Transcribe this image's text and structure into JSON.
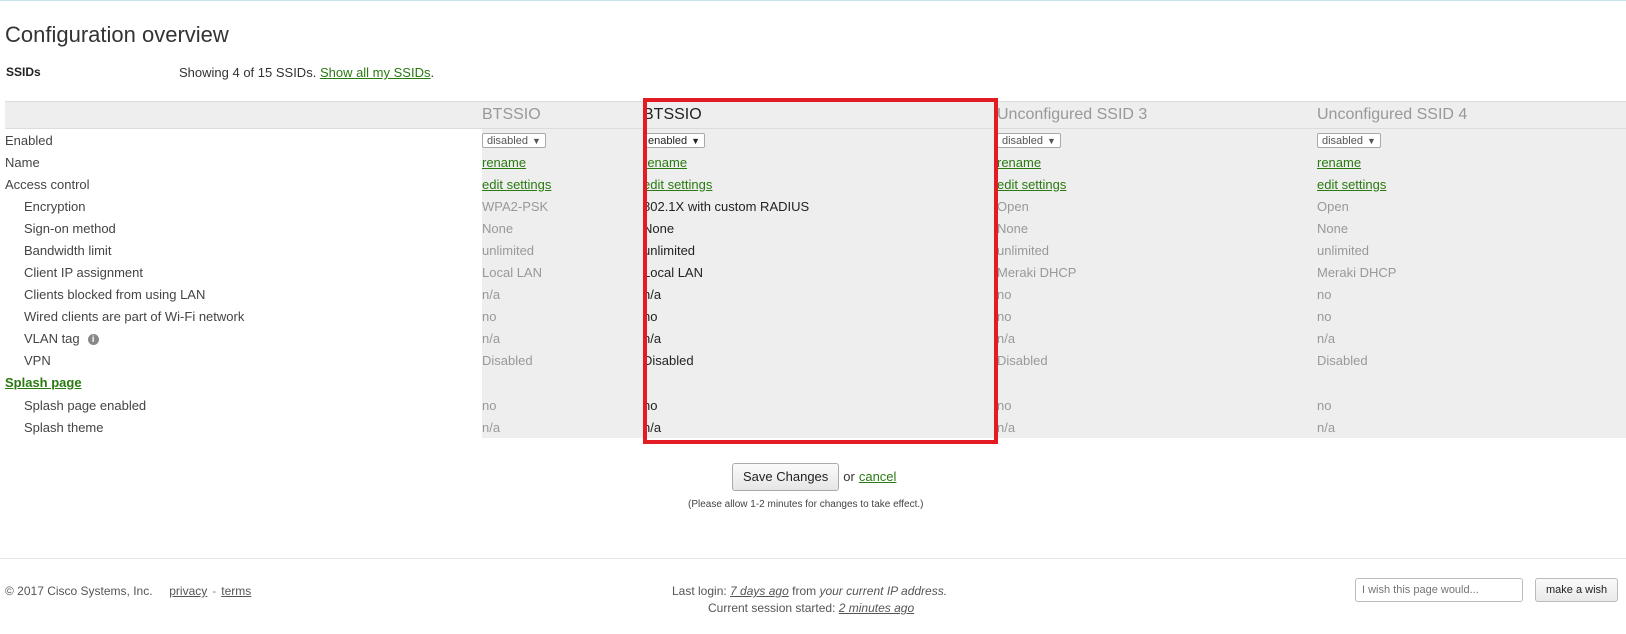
{
  "page": {
    "title": "Configuration overview",
    "ssids_label": "SSIDs",
    "ssids_info": "Showing 4 of 15 SSIDs.",
    "show_all_link": "Show all my SSIDs",
    "show_all_suffix": "."
  },
  "table": {
    "columns": [
      {
        "name": "BTSSIO",
        "enabled": "disabled",
        "rename": "rename",
        "access": "edit settings",
        "encryption": "WPA2-PSK",
        "signon": "None",
        "bandwidth": "unlimited",
        "client_ip": "Local LAN",
        "clients_blocked": "n/a",
        "wired_clients": "no",
        "vlan": "n/a",
        "vpn": "Disabled",
        "splash_enabled": "no",
        "splash_theme": "n/a"
      },
      {
        "name": "BTSSIO",
        "enabled": "enabled",
        "rename": "rename",
        "access": "edit settings",
        "encryption": "802.1X with custom RADIUS",
        "signon": "None",
        "bandwidth": "unlimited",
        "client_ip": "Local LAN",
        "clients_blocked": "n/a",
        "wired_clients": "no",
        "vlan": "n/a",
        "vpn": "Disabled",
        "splash_enabled": "no",
        "splash_theme": "n/a"
      },
      {
        "name": "Unconfigured SSID 3",
        "enabled": "disabled",
        "rename": "rename",
        "access": "edit settings",
        "encryption": "Open",
        "signon": "None",
        "bandwidth": "unlimited",
        "client_ip": "Meraki DHCP",
        "clients_blocked": "no",
        "wired_clients": "no",
        "vlan": "n/a",
        "vpn": "Disabled",
        "splash_enabled": "no",
        "splash_theme": "n/a"
      },
      {
        "name": "Unconfigured SSID 4",
        "enabled": "disabled",
        "rename": "rename",
        "access": "edit settings",
        "encryption": "Open",
        "signon": "None",
        "bandwidth": "unlimited",
        "client_ip": "Meraki DHCP",
        "clients_blocked": "no",
        "wired_clients": "no",
        "vlan": "n/a",
        "vpn": "Disabled",
        "splash_enabled": "no",
        "splash_theme": "n/a"
      }
    ],
    "labels": {
      "enabled": "Enabled",
      "name": "Name",
      "access": "Access control",
      "encryption": "Encryption",
      "signon": "Sign-on method",
      "bandwidth": "Bandwidth limit",
      "client_ip": "Client IP assignment",
      "clients_blocked": "Clients blocked from using LAN",
      "wired_clients": "Wired clients are part of Wi-Fi network",
      "vlan": "VLAN tag",
      "vpn": "VPN",
      "splash_section": "Splash page",
      "splash_enabled": "Splash page enabled",
      "splash_theme": "Splash theme"
    },
    "dropdown_caret": "▼",
    "info_icon": "i"
  },
  "actions": {
    "save_label": "Save Changes",
    "or_text": "or",
    "cancel_label": "cancel",
    "note": "(Please allow 1-2 minutes for changes to take effect.)"
  },
  "footer": {
    "copyright": "© 2017 Cisco Systems, Inc.",
    "privacy": "privacy",
    "separator": "-",
    "terms": "terms",
    "last_login_prefix": "Last login:",
    "last_login_link": "7 days ago",
    "last_login_mid": "from",
    "last_login_suffix": "your current IP address.",
    "session_prefix": "Current session started:",
    "session_link": "2 minutes ago",
    "wish_placeholder": "I wish this page would...",
    "wish_button": "make a wish"
  },
  "colors": {
    "link": "#2a7a12",
    "highlight": "#e31b23",
    "column_bg": "#eeeeee"
  }
}
